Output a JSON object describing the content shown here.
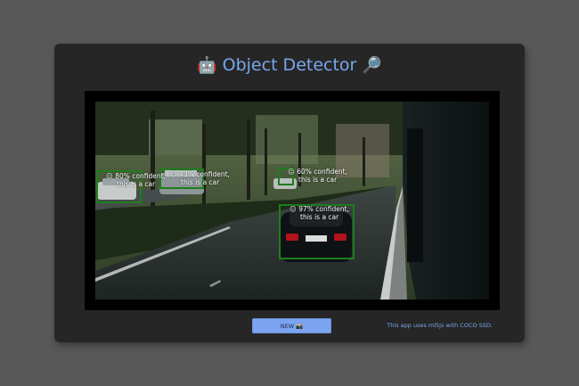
{
  "app": {
    "title": "Object Detector",
    "title_icon_left": "🤖",
    "title_icon_right": "🔎"
  },
  "detections": [
    {
      "emoji": "😐",
      "text": "80% confident,",
      "text2": "this is a car"
    },
    {
      "emoji": "😐",
      "text": "73% confident,",
      "text2": "this is a car"
    },
    {
      "emoji": "😐",
      "text": "60% confident,",
      "text2": "this is a car"
    },
    {
      "emoji": "😐",
      "text": "97% confident,",
      "text2": "this is a car"
    }
  ],
  "controls": {
    "new_button_label": "NEW 📸"
  },
  "footer": {
    "note": "This app uses ml5js with COCO SSD."
  },
  "colors": {
    "page_bg": "#585858",
    "card_bg": "#262626",
    "accent": "#79a6ee",
    "box_stroke": "#1e7d1e"
  }
}
